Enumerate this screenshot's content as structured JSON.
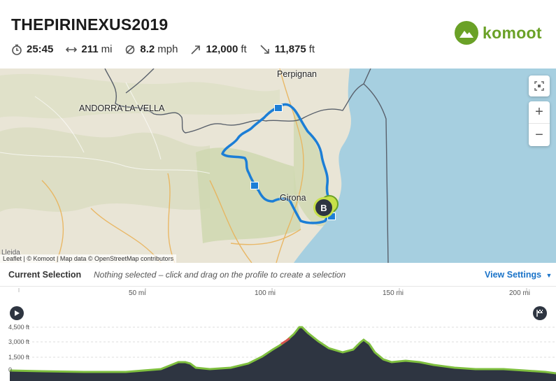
{
  "tour": {
    "title": "THEPIRINEXUS2019",
    "stats": [
      {
        "icon": "clock-icon",
        "value": "25:45",
        "unit": ""
      },
      {
        "icon": "distance-icon",
        "value": "211",
        "unit": "mi"
      },
      {
        "icon": "speed-icon",
        "value": "8.2",
        "unit": "mph"
      },
      {
        "icon": "uphill-icon",
        "value": "12,000",
        "unit": "ft"
      },
      {
        "icon": "downhill-icon",
        "value": "11,875",
        "unit": "ft"
      }
    ]
  },
  "brand": {
    "name": "komoot",
    "color": "#6aa127"
  },
  "map": {
    "labels": {
      "perpignan": "Perpignan",
      "andorra": "ANDORRA LA VELLA",
      "girona": "Girona",
      "lleida": "Lleida"
    },
    "markers": {
      "end": "B"
    },
    "attribution": "Leaflet | © Komoot | Map data © OpenStreetMap contributors",
    "controls": {
      "zoom_in": "+",
      "zoom_out": "−"
    },
    "colors": {
      "route": "#1c7ed6",
      "sea": "#a6cfe0",
      "land": "#e9e5d6",
      "forest": "#cfd8b0",
      "border": "#59606b"
    }
  },
  "selection": {
    "label": "Current Selection",
    "hint": "Nothing selected – click and drag on the profile to create a selection",
    "view_settings": "View Settings"
  },
  "profile": {
    "distance_ticks": [
      "50 mi",
      "100 mi",
      "150 mi",
      "200 mi"
    ],
    "elevation_ticks": [
      "4,500 ft",
      "3,000 ft",
      "1,500 ft",
      "0"
    ],
    "colors": {
      "fill": "#2e3541",
      "outline": "#7fbf3f",
      "highlight": "#d9534f"
    }
  }
}
